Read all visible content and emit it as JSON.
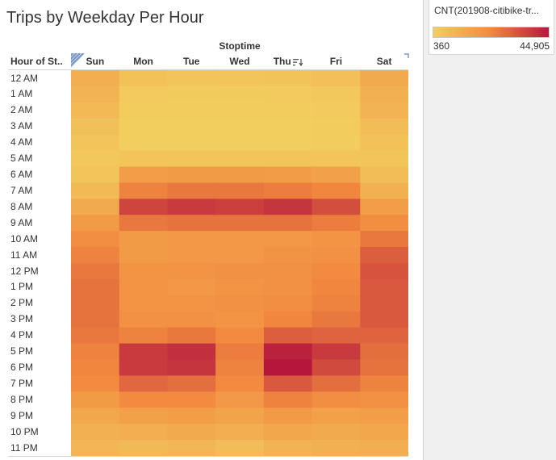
{
  "title": "Trips by Weekday Per Hour",
  "column_group_label": "Stoptime",
  "row_header_label": "Hour of St..",
  "legend": {
    "title": "CNT(201908-citibike-tr...",
    "min_label": "360",
    "max_label": "44,905",
    "color_low": "#f2cf5f",
    "color_mid": "#f2893f",
    "color_high": "#b5173c"
  },
  "icons": {
    "corner": "corner-fold-icon",
    "sort": "sort-descending-icon"
  },
  "chart_data": {
    "type": "heatmap",
    "title": "Trips by Weekday Per Hour",
    "x_group_label": "Stoptime",
    "y_label": "Hour of St..",
    "columns": [
      "Sun",
      "Mon",
      "Tue",
      "Wed",
      "Thu",
      "Fri",
      "Sat"
    ],
    "rows": [
      "12 AM",
      "1 AM",
      "2 AM",
      "3 AM",
      "4 AM",
      "5 AM",
      "6 AM",
      "7 AM",
      "8 AM",
      "9 AM",
      "10 AM",
      "11 AM",
      "12 PM",
      "1 PM",
      "2 PM",
      "3 PM",
      "4 PM",
      "5 PM",
      "6 PM",
      "7 PM",
      "8 PM",
      "9 PM",
      "10 PM",
      "11 PM"
    ],
    "color_range": [
      360,
      44905
    ],
    "values": [
      [
        11000,
        4500,
        3500,
        4000,
        4200,
        5500,
        12000
      ],
      [
        9000,
        2000,
        1600,
        1700,
        1800,
        2800,
        10000
      ],
      [
        7500,
        1100,
        900,
        900,
        1000,
        1800,
        9000
      ],
      [
        5000,
        700,
        600,
        600,
        650,
        1000,
        6500
      ],
      [
        3500,
        800,
        700,
        700,
        750,
        900,
        4500
      ],
      [
        2500,
        4000,
        3800,
        3800,
        3900,
        3800,
        3500
      ],
      [
        3500,
        16000,
        17000,
        17000,
        16500,
        15000,
        6000
      ],
      [
        7000,
        24000,
        26000,
        26000,
        25000,
        23000,
        10000
      ],
      [
        12000,
        36000,
        38000,
        37000,
        39000,
        34000,
        16000
      ],
      [
        17000,
        26000,
        27000,
        27000,
        27000,
        25000,
        21000
      ],
      [
        21000,
        17000,
        18000,
        18000,
        18000,
        19000,
        26000
      ],
      [
        24000,
        17000,
        18000,
        18000,
        19000,
        20000,
        31000
      ],
      [
        26000,
        19000,
        19000,
        20000,
        20000,
        22000,
        33000
      ],
      [
        27000,
        19000,
        18000,
        19000,
        20000,
        23000,
        32000
      ],
      [
        27000,
        19000,
        19000,
        20000,
        21000,
        24000,
        32000
      ],
      [
        27000,
        20000,
        20000,
        19000,
        23000,
        26000,
        32000
      ],
      [
        26000,
        24000,
        26000,
        22000,
        31000,
        30000,
        30000
      ],
      [
        24000,
        38000,
        40000,
        25000,
        43000,
        38000,
        28000
      ],
      [
        23000,
        38000,
        39000,
        24000,
        44905,
        35000,
        27000
      ],
      [
        22000,
        29000,
        28000,
        22000,
        32000,
        28000,
        24000
      ],
      [
        17000,
        22000,
        22000,
        18000,
        24000,
        21000,
        20000
      ],
      [
        13000,
        15000,
        16000,
        14000,
        17000,
        15000,
        16000
      ],
      [
        10000,
        11000,
        12000,
        11000,
        13000,
        12000,
        13000
      ],
      [
        8000,
        7000,
        8000,
        6000,
        9000,
        10000,
        11000
      ]
    ]
  }
}
